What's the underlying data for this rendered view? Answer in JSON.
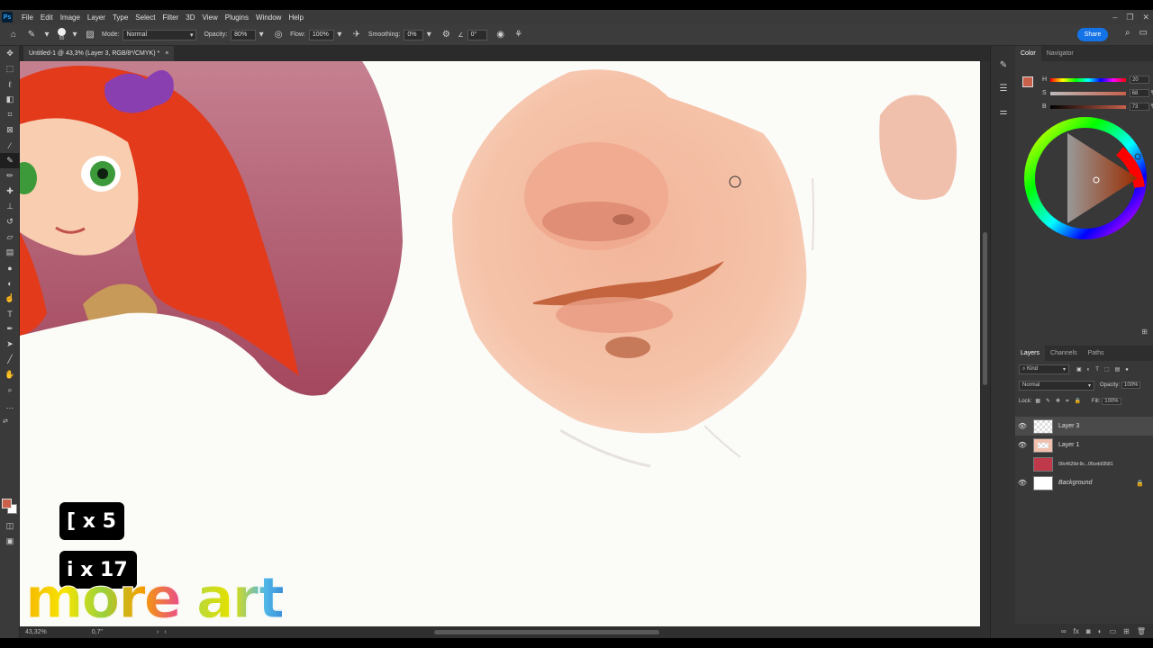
{
  "app": {
    "logo": "Ps"
  },
  "menu": [
    "File",
    "Edit",
    "Image",
    "Layer",
    "Type",
    "Select",
    "Filter",
    "3D",
    "View",
    "Plugins",
    "Window",
    "Help"
  ],
  "options": {
    "brush_size": "50",
    "mode_label": "Mode:",
    "mode_value": "Normal",
    "opacity_label": "Opacity:",
    "opacity_value": "80%",
    "flow_label": "Flow:",
    "flow_value": "100%",
    "smoothing_label": "Smoothing:",
    "smoothing_value": "0%",
    "angle_value": "0°",
    "share_label": "Share"
  },
  "document": {
    "tab_title": "Untitled-1 @ 43,3% (Layer 3, RGB/8*/CMYK) *",
    "close": "×"
  },
  "status": {
    "zoom": "43,32%",
    "info": "0,7\""
  },
  "color_panel": {
    "tabs": [
      "Color",
      "Navigator"
    ],
    "h_label": "H",
    "h_value": "20",
    "s_label": "S",
    "s_value": "68",
    "b_label": "B",
    "b_value": "73",
    "unit": "%",
    "foreground": "#c8604a"
  },
  "layers_panel": {
    "tabs": [
      "Layers",
      "Channels",
      "Paths"
    ],
    "kind_label": "Kind",
    "blend_mode": "Normal",
    "opacity_label": "Opacity:",
    "opacity_value": "100%",
    "lock_label": "Lock:",
    "fill_label": "Fill:",
    "fill_value": "100%",
    "layers": [
      {
        "name": "Layer 3",
        "visible": true,
        "selected": true
      },
      {
        "name": "Layer 1",
        "visible": true,
        "selected": false
      },
      {
        "name": "00c4629d-9c...05ceb03581",
        "visible": false,
        "selected": false
      },
      {
        "name": "Background",
        "visible": true,
        "selected": false,
        "locked": true
      }
    ]
  },
  "overlay": {
    "badge1": "[ x 5",
    "badge2": "i x 17",
    "brand_word1": "more",
    "brand_word2": "art"
  }
}
